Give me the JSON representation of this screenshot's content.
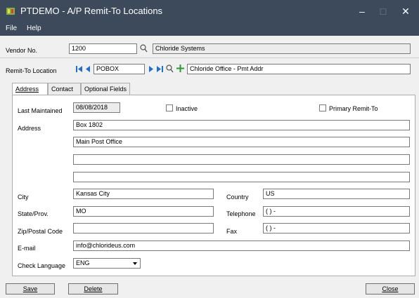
{
  "window": {
    "title": "PTDEMO - A/P Remit-To Locations",
    "minimize": "–",
    "maximize": "□",
    "close": "✕"
  },
  "menu": {
    "file": "File",
    "help": "Help"
  },
  "header": {
    "vendor_label": "Vendor No.",
    "vendor_no": "1200",
    "vendor_name": "Chloride Systems",
    "remit_label": "Remit-To Location",
    "remit_code": "POBOX",
    "remit_desc": "Chloride Office - Pmt Addr"
  },
  "tabs": [
    {
      "label": "Address"
    },
    {
      "label": "Contact"
    },
    {
      "label": "Optional Fields"
    }
  ],
  "form": {
    "last_maintained_label": "Last Maintained",
    "last_maintained": "08/08/2018",
    "inactive_label": "Inactive",
    "primary_label": "Primary Remit-To",
    "address_label": "Address",
    "address1": "Box 1802",
    "address2": "Main Post Office",
    "address3": "",
    "address4": "",
    "city_label": "City",
    "city": "Kansas City",
    "country_label": "Country",
    "country": "US",
    "state_label": "State/Prov.",
    "state": "MO",
    "telephone_label": "Telephone",
    "telephone": "( )  -",
    "zip_label": "Zip/Postal Code",
    "zip": "",
    "fax_label": "Fax",
    "fax": "( )  -",
    "email_label": "E-mail",
    "email": "info@chlorideus.com",
    "lang_label": "Check Language",
    "lang": "ENG"
  },
  "buttons": {
    "save": "Save",
    "delete": "Delete",
    "close": "Close"
  },
  "icons": {
    "finder": "magnifier-icon",
    "add": "plus-icon",
    "nav": "navigation-arrows-icon"
  },
  "colors": {
    "titlebar": "#3c4a5c",
    "nav_arrows": "#1e6fd0",
    "add": "#2a9a2a"
  }
}
